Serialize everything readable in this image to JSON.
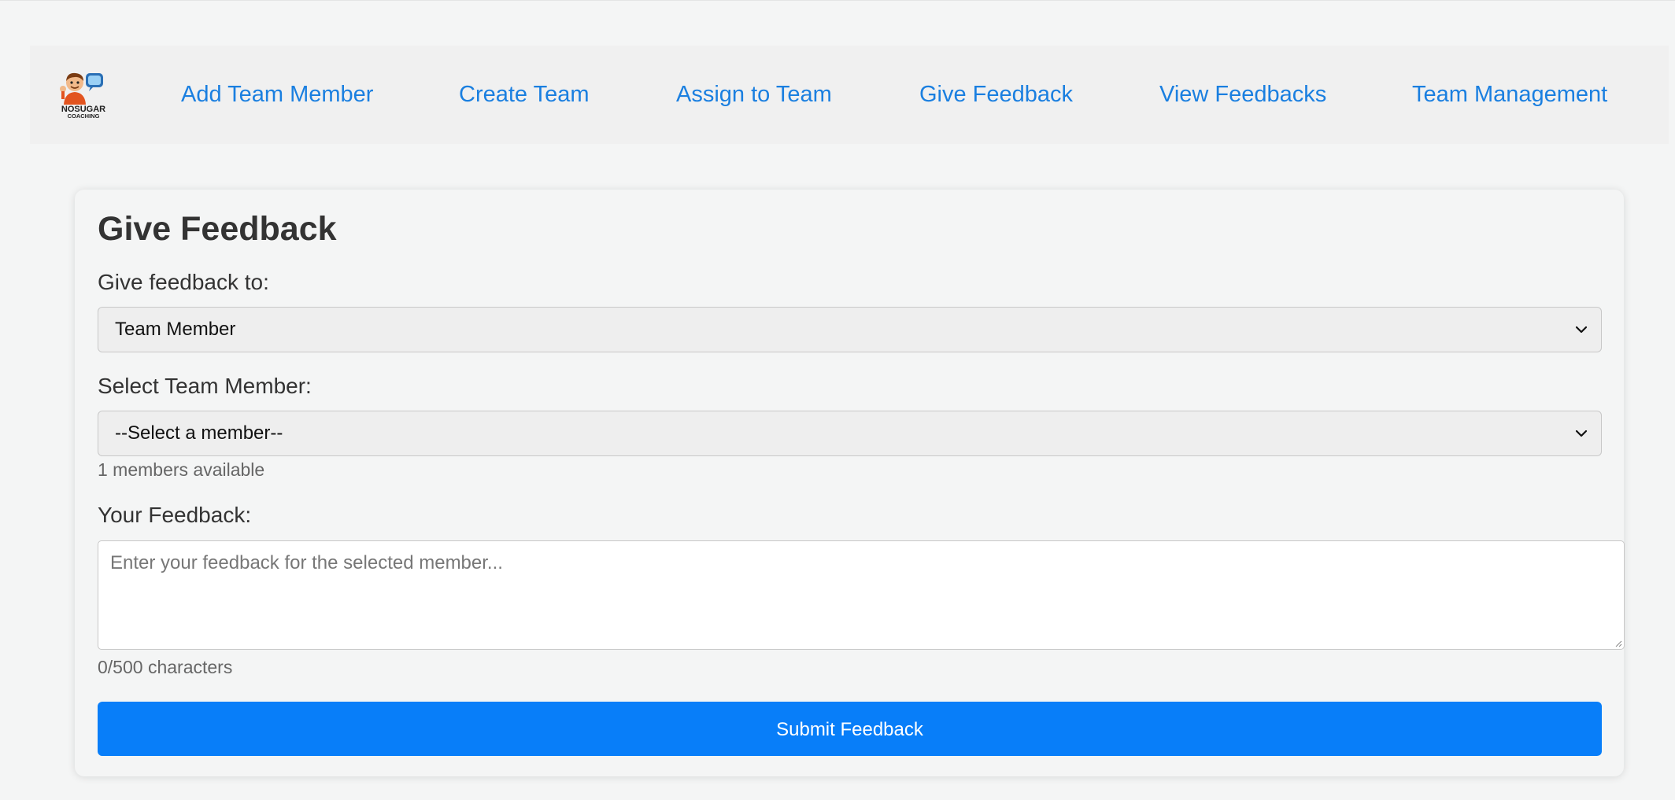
{
  "nav": {
    "logo": {
      "text_line1": "NOSUGAR",
      "text_line2": "COACHING"
    },
    "links": [
      "Add Team Member",
      "Create Team",
      "Assign to Team",
      "Give Feedback",
      "View Feedbacks",
      "Team Management"
    ]
  },
  "form": {
    "title": "Give Feedback",
    "target_label": "Give feedback to:",
    "target_value": "Team Member",
    "member_label": "Select Team Member:",
    "member_value": "--Select a member--",
    "member_hint": "1 members available",
    "feedback_label": "Your Feedback:",
    "feedback_placeholder": "Enter your feedback for the selected member...",
    "char_count": "0/500 characters",
    "submit_label": "Submit Feedback"
  },
  "colors": {
    "accent": "#087ef9",
    "link": "#1a7fe0",
    "nav_bg": "#f0f0f0",
    "page_bg": "#f4f5f5"
  },
  "icons": [
    "chevron-down-icon",
    "resize-grip-icon",
    "coaching-logo"
  ]
}
